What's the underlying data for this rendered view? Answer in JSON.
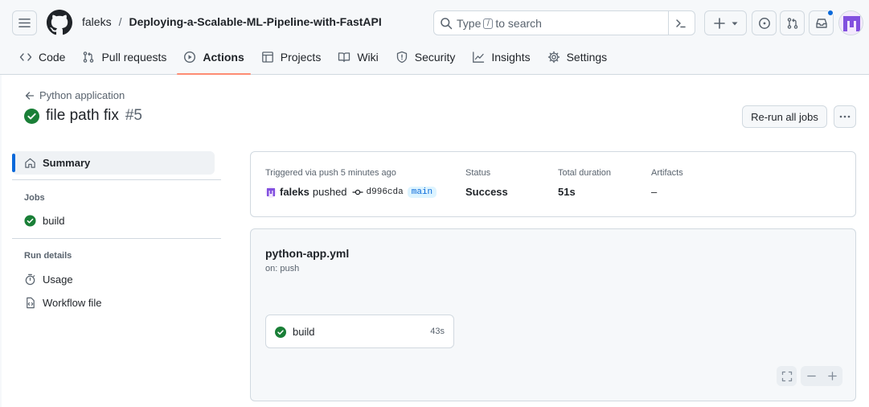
{
  "header": {
    "owner": "faleks",
    "separator": "/",
    "repo": "Deploying-a-Scalable-ML-Pipeline-with-FastAPI",
    "search": {
      "before": "Type",
      "key": "/",
      "after": "to search"
    }
  },
  "tabs": [
    {
      "label": "Code",
      "icon": "code-icon"
    },
    {
      "label": "Pull requests",
      "icon": "git-pull-request-icon"
    },
    {
      "label": "Actions",
      "icon": "play-icon",
      "selected": true
    },
    {
      "label": "Projects",
      "icon": "table-icon"
    },
    {
      "label": "Wiki",
      "icon": "book-icon"
    },
    {
      "label": "Security",
      "icon": "shield-icon"
    },
    {
      "label": "Insights",
      "icon": "graph-icon"
    },
    {
      "label": "Settings",
      "icon": "gear-icon"
    }
  ],
  "run": {
    "workflow_link": "Python application",
    "title": "file path fix",
    "number": "#5",
    "rerun_label": "Re-run all jobs"
  },
  "sidebar": {
    "summary": "Summary",
    "jobs_heading": "Jobs",
    "job": "build",
    "details_heading": "Run details",
    "usage": "Usage",
    "workflow_file": "Workflow file"
  },
  "summary": {
    "trigger_label": "Triggered via push 5 minutes ago",
    "actor": "faleks",
    "action": "pushed",
    "sha": "d996cda",
    "branch": "main",
    "status_label": "Status",
    "status_value": "Success",
    "duration_label": "Total duration",
    "duration_value": "51s",
    "artifacts_label": "Artifacts",
    "artifacts_value": "–"
  },
  "graph": {
    "workflow_file": "python-app.yml",
    "trigger": "on: push",
    "job": {
      "name": "build",
      "duration": "43s"
    }
  },
  "colors": {
    "success": "#1a7f37",
    "accent": "#0969da",
    "tab_underline": "#fd8c73",
    "avatar": "#8250df"
  }
}
